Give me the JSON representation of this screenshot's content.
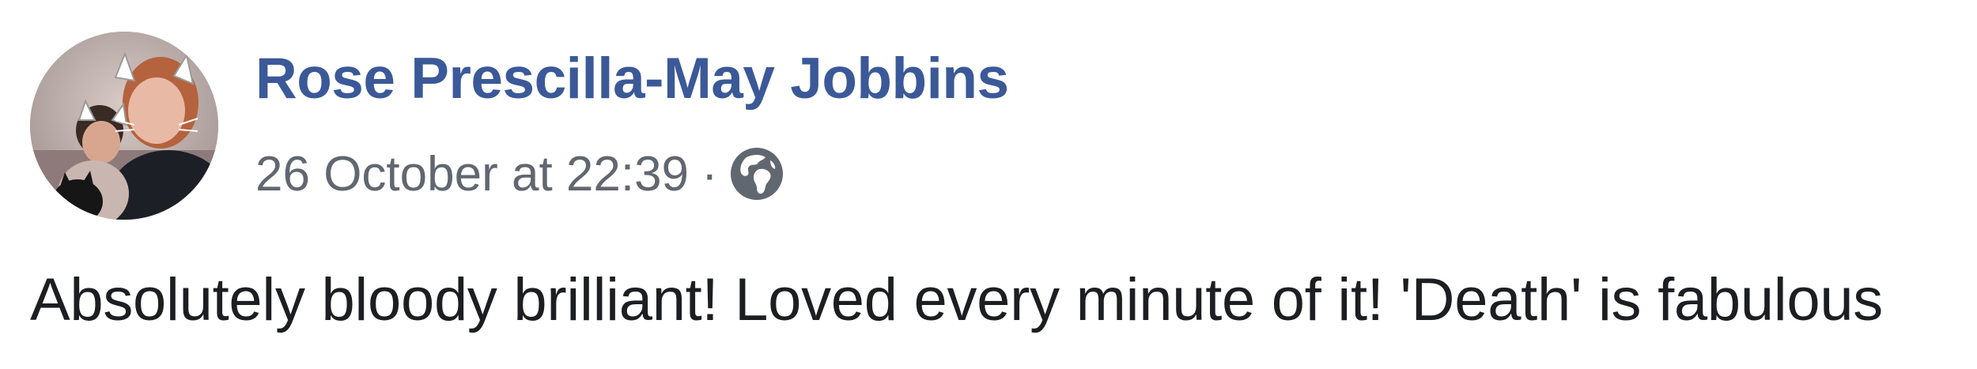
{
  "post": {
    "author_name": "Rose Prescilla-May Jobbins",
    "timestamp": "26 October at 22:39",
    "separator": "·",
    "audience_icon": "globe-icon",
    "text": "Absolutely bloody brilliant! Loved every minute of it! 'Death' is fabulous"
  },
  "colors": {
    "author_link": "#3b5998",
    "meta_text": "#616770",
    "body_text": "#1c1e21",
    "globe": "#616770"
  }
}
